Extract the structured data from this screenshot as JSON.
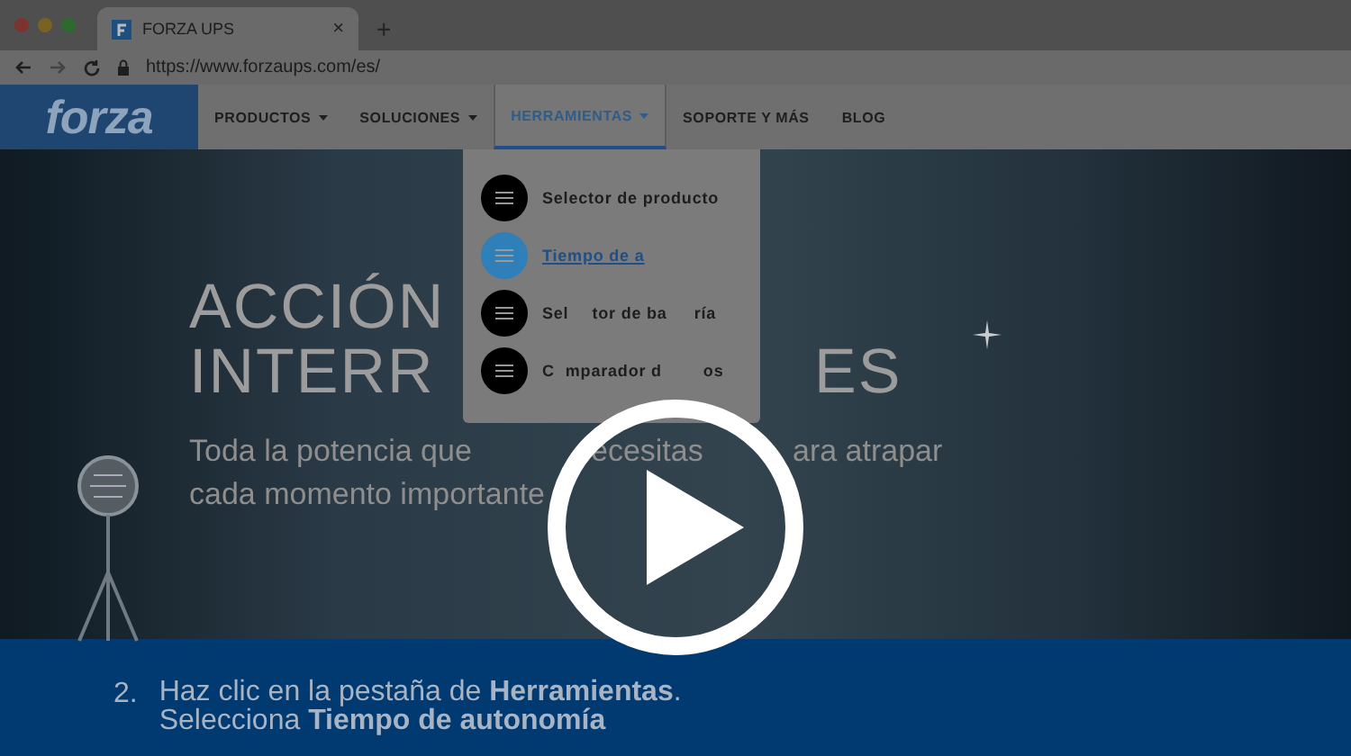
{
  "browser": {
    "tab_title": "FORZA UPS",
    "tab_close": "×",
    "new_tab": "+",
    "url": "https://www.forzaups.com/es/"
  },
  "nav": {
    "logo": "forza",
    "items": [
      {
        "label": "PRODUCTOS",
        "has_menu": true,
        "selected": false
      },
      {
        "label": "SOLUCIONES",
        "has_menu": true,
        "selected": false
      },
      {
        "label": "HERRAMIENTAS",
        "has_menu": true,
        "selected": true
      },
      {
        "label": "SOPORTE Y MÁS",
        "has_menu": false,
        "selected": false
      },
      {
        "label": "BLOG",
        "has_menu": false,
        "selected": false
      }
    ]
  },
  "dropdown": {
    "items": [
      {
        "label_parts": [
          "Selector de producto"
        ],
        "selected": false
      },
      {
        "label_parts": [
          "Tiempo de a"
        ],
        "selected": true
      },
      {
        "label_parts": [
          "Sel",
          "tor de ba",
          "ría"
        ],
        "selected": false
      },
      {
        "label_parts": [
          "C",
          "mparador d",
          "os"
        ],
        "selected": false
      }
    ]
  },
  "hero": {
    "heading_lines": [
      [
        "ACCIÓN"
      ],
      [
        "INTERR",
        "ES"
      ]
    ],
    "tagline_lines": [
      [
        "Toda la potencia que",
        "ecesitas",
        "ara atrapar"
      ],
      [
        "cada momento importante"
      ]
    ]
  },
  "caption": {
    "number": "2.",
    "lines": [
      "Haz clic en la pestaña de **Herramientas**.",
      "Selecciona **Tiempo de autonomía**"
    ]
  }
}
